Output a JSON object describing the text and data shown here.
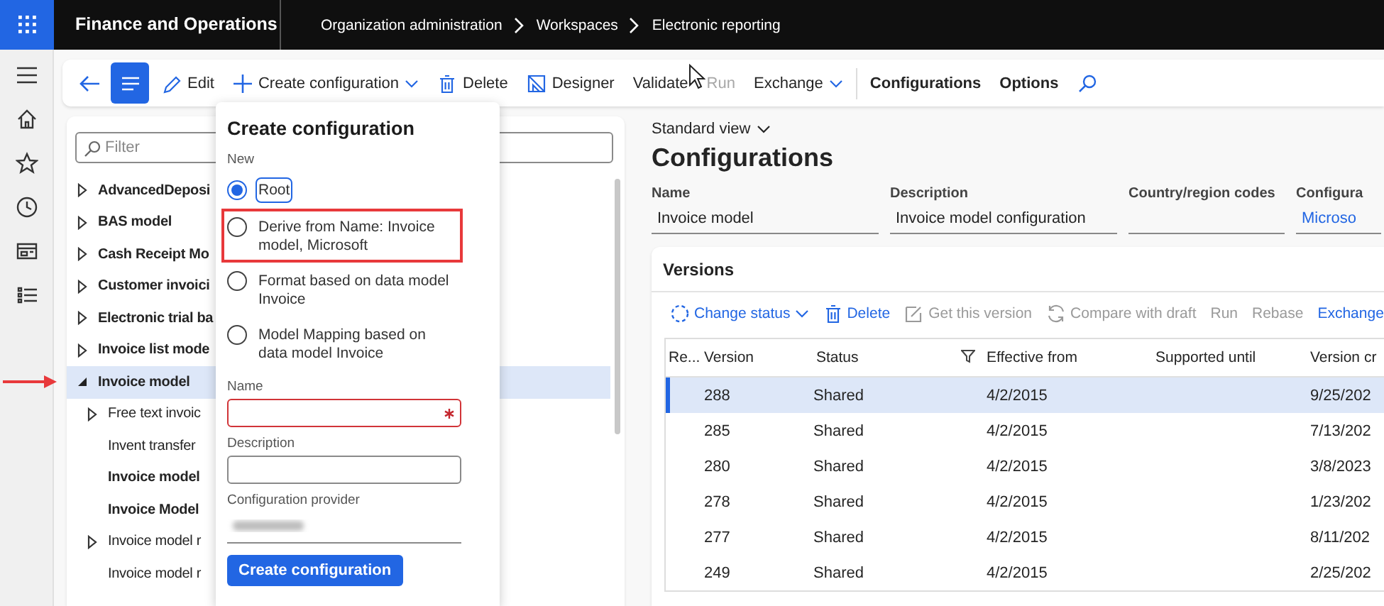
{
  "app": {
    "title": "Finance and Operations",
    "breadcrumb": [
      "Organization administration",
      "Workspaces",
      "Electronic reporting"
    ]
  },
  "toolbar": {
    "list_view_pressed": true,
    "actions": [
      {
        "kind": "edit",
        "label": "Edit",
        "dropdown": false,
        "disabled": false
      },
      {
        "kind": "add",
        "label": "Create configuration",
        "dropdown": true,
        "disabled": false
      },
      {
        "kind": "delete",
        "label": "Delete",
        "dropdown": false,
        "disabled": false
      },
      {
        "kind": "designer",
        "label": "Designer",
        "dropdown": false,
        "disabled": false
      },
      {
        "kind": "text",
        "label": "Validate",
        "dropdown": false,
        "disabled": false
      },
      {
        "kind": "text",
        "label": "Run",
        "dropdown": false,
        "disabled": true
      },
      {
        "kind": "text",
        "label": "Exchange",
        "dropdown": true,
        "disabled": false
      }
    ],
    "tabs": [
      "Configurations",
      "Options"
    ]
  },
  "tree": {
    "filter_placeholder": "Filter",
    "items": [
      {
        "label": "AdvancedDeposi",
        "expandable": true,
        "expanded": false,
        "emphasized": true,
        "selected": false,
        "marked": false
      },
      {
        "label": "BAS model",
        "expandable": true,
        "expanded": false,
        "emphasized": true,
        "selected": false,
        "marked": false
      },
      {
        "label": "Cash Receipt Mo",
        "expandable": true,
        "expanded": false,
        "emphasized": true,
        "selected": false,
        "marked": false
      },
      {
        "label": "Customer invoici",
        "expandable": true,
        "expanded": false,
        "emphasized": true,
        "selected": false,
        "marked": false
      },
      {
        "label": "Electronic trial ba",
        "expandable": true,
        "expanded": false,
        "emphasized": true,
        "selected": false,
        "marked": false
      },
      {
        "label": "Invoice list mode",
        "expandable": true,
        "expanded": false,
        "emphasized": true,
        "selected": false,
        "marked": false
      },
      {
        "label": "Invoice model",
        "expandable": true,
        "expanded": true,
        "emphasized": true,
        "selected": true,
        "marked": true,
        "children": [
          {
            "label": "Free text invoic",
            "expandable": true,
            "expanded": false,
            "emphasized": false,
            "selected": false
          },
          {
            "label": "Invent transfer",
            "expandable": false,
            "emphasized": false,
            "selected": false
          },
          {
            "label": "Invoice model",
            "expandable": false,
            "emphasized": true,
            "selected": false
          },
          {
            "label": "Invoice Model",
            "expandable": false,
            "emphasized": true,
            "selected": false
          },
          {
            "label": "Invoice model r",
            "expandable": true,
            "expanded": false,
            "emphasized": false,
            "selected": false
          },
          {
            "label": "Invoice model r",
            "expandable": false,
            "emphasized": false,
            "selected": false
          }
        ]
      }
    ]
  },
  "popup": {
    "title": "Create configuration",
    "section": "New",
    "options": [
      {
        "label": "Root",
        "selected": true,
        "focused": true,
        "highlighted": false
      },
      {
        "label": "Derive from Name: Invoice model, Microsoft",
        "selected": false,
        "focused": false,
        "highlighted": true
      },
      {
        "label": "Format based on data model Invoice",
        "selected": false,
        "focused": false,
        "highlighted": false
      },
      {
        "label": "Model Mapping based on data model Invoice",
        "selected": false,
        "focused": false,
        "highlighted": false
      }
    ],
    "fields": [
      {
        "label": "Name",
        "required": true,
        "invalid": true
      },
      {
        "label": "Description",
        "required": false,
        "invalid": false
      }
    ],
    "provider_label": "Configuration provider",
    "button": "Create configuration"
  },
  "details": {
    "view": "Standard view",
    "title": "Configurations",
    "fields": [
      {
        "label": "Name",
        "value": "Invoice model",
        "kind": "text"
      },
      {
        "label": "Description",
        "value": "Invoice model configuration",
        "kind": "text"
      },
      {
        "label": "Country/region codes",
        "kind": "text"
      },
      {
        "label": "Configura",
        "value": "Microso",
        "kind": "link"
      }
    ]
  },
  "versions": {
    "title": "Versions",
    "actions": [
      {
        "kind": "status",
        "label": "Change status",
        "dropdown": true,
        "disabled": false
      },
      {
        "kind": "delete",
        "label": "Delete",
        "dropdown": false,
        "disabled": false
      },
      {
        "kind": "get",
        "label": "Get this version",
        "dropdown": false,
        "disabled": true
      },
      {
        "kind": "compare",
        "label": "Compare with draft",
        "dropdown": false,
        "disabled": true
      },
      {
        "kind": "text",
        "label": "Run",
        "dropdown": false,
        "disabled": true
      },
      {
        "kind": "text",
        "label": "Rebase",
        "dropdown": false,
        "disabled": true
      },
      {
        "kind": "text",
        "label": "Exchange",
        "dropdown": false,
        "disabled": false
      }
    ],
    "columns": [
      {
        "label": "Re...",
        "filtered": false
      },
      {
        "label": "Version",
        "filtered": false
      },
      {
        "label": "Status",
        "filtered": true
      },
      {
        "label": "Effective from",
        "filtered": false
      },
      {
        "label": "Supported until",
        "filtered": false
      },
      {
        "label": "Version cr",
        "filtered": false
      }
    ],
    "rows": [
      {
        "version": "288",
        "status": "Shared",
        "effective_from": "4/2/2015",
        "version_created": "9/25/202",
        "selected": true
      },
      {
        "version": "285",
        "status": "Shared",
        "effective_from": "4/2/2015",
        "version_created": "7/13/202",
        "selected": false
      },
      {
        "version": "280",
        "status": "Shared",
        "effective_from": "4/2/2015",
        "version_created": "3/8/2023",
        "selected": false
      },
      {
        "version": "278",
        "status": "Shared",
        "effective_from": "4/2/2015",
        "version_created": "1/23/202",
        "selected": false
      },
      {
        "version": "277",
        "status": "Shared",
        "effective_from": "4/2/2015",
        "version_created": "8/11/202",
        "selected": false
      },
      {
        "version": "249",
        "status": "Shared",
        "effective_from": "4/2/2015",
        "version_created": "2/25/202",
        "selected": false
      }
    ]
  }
}
